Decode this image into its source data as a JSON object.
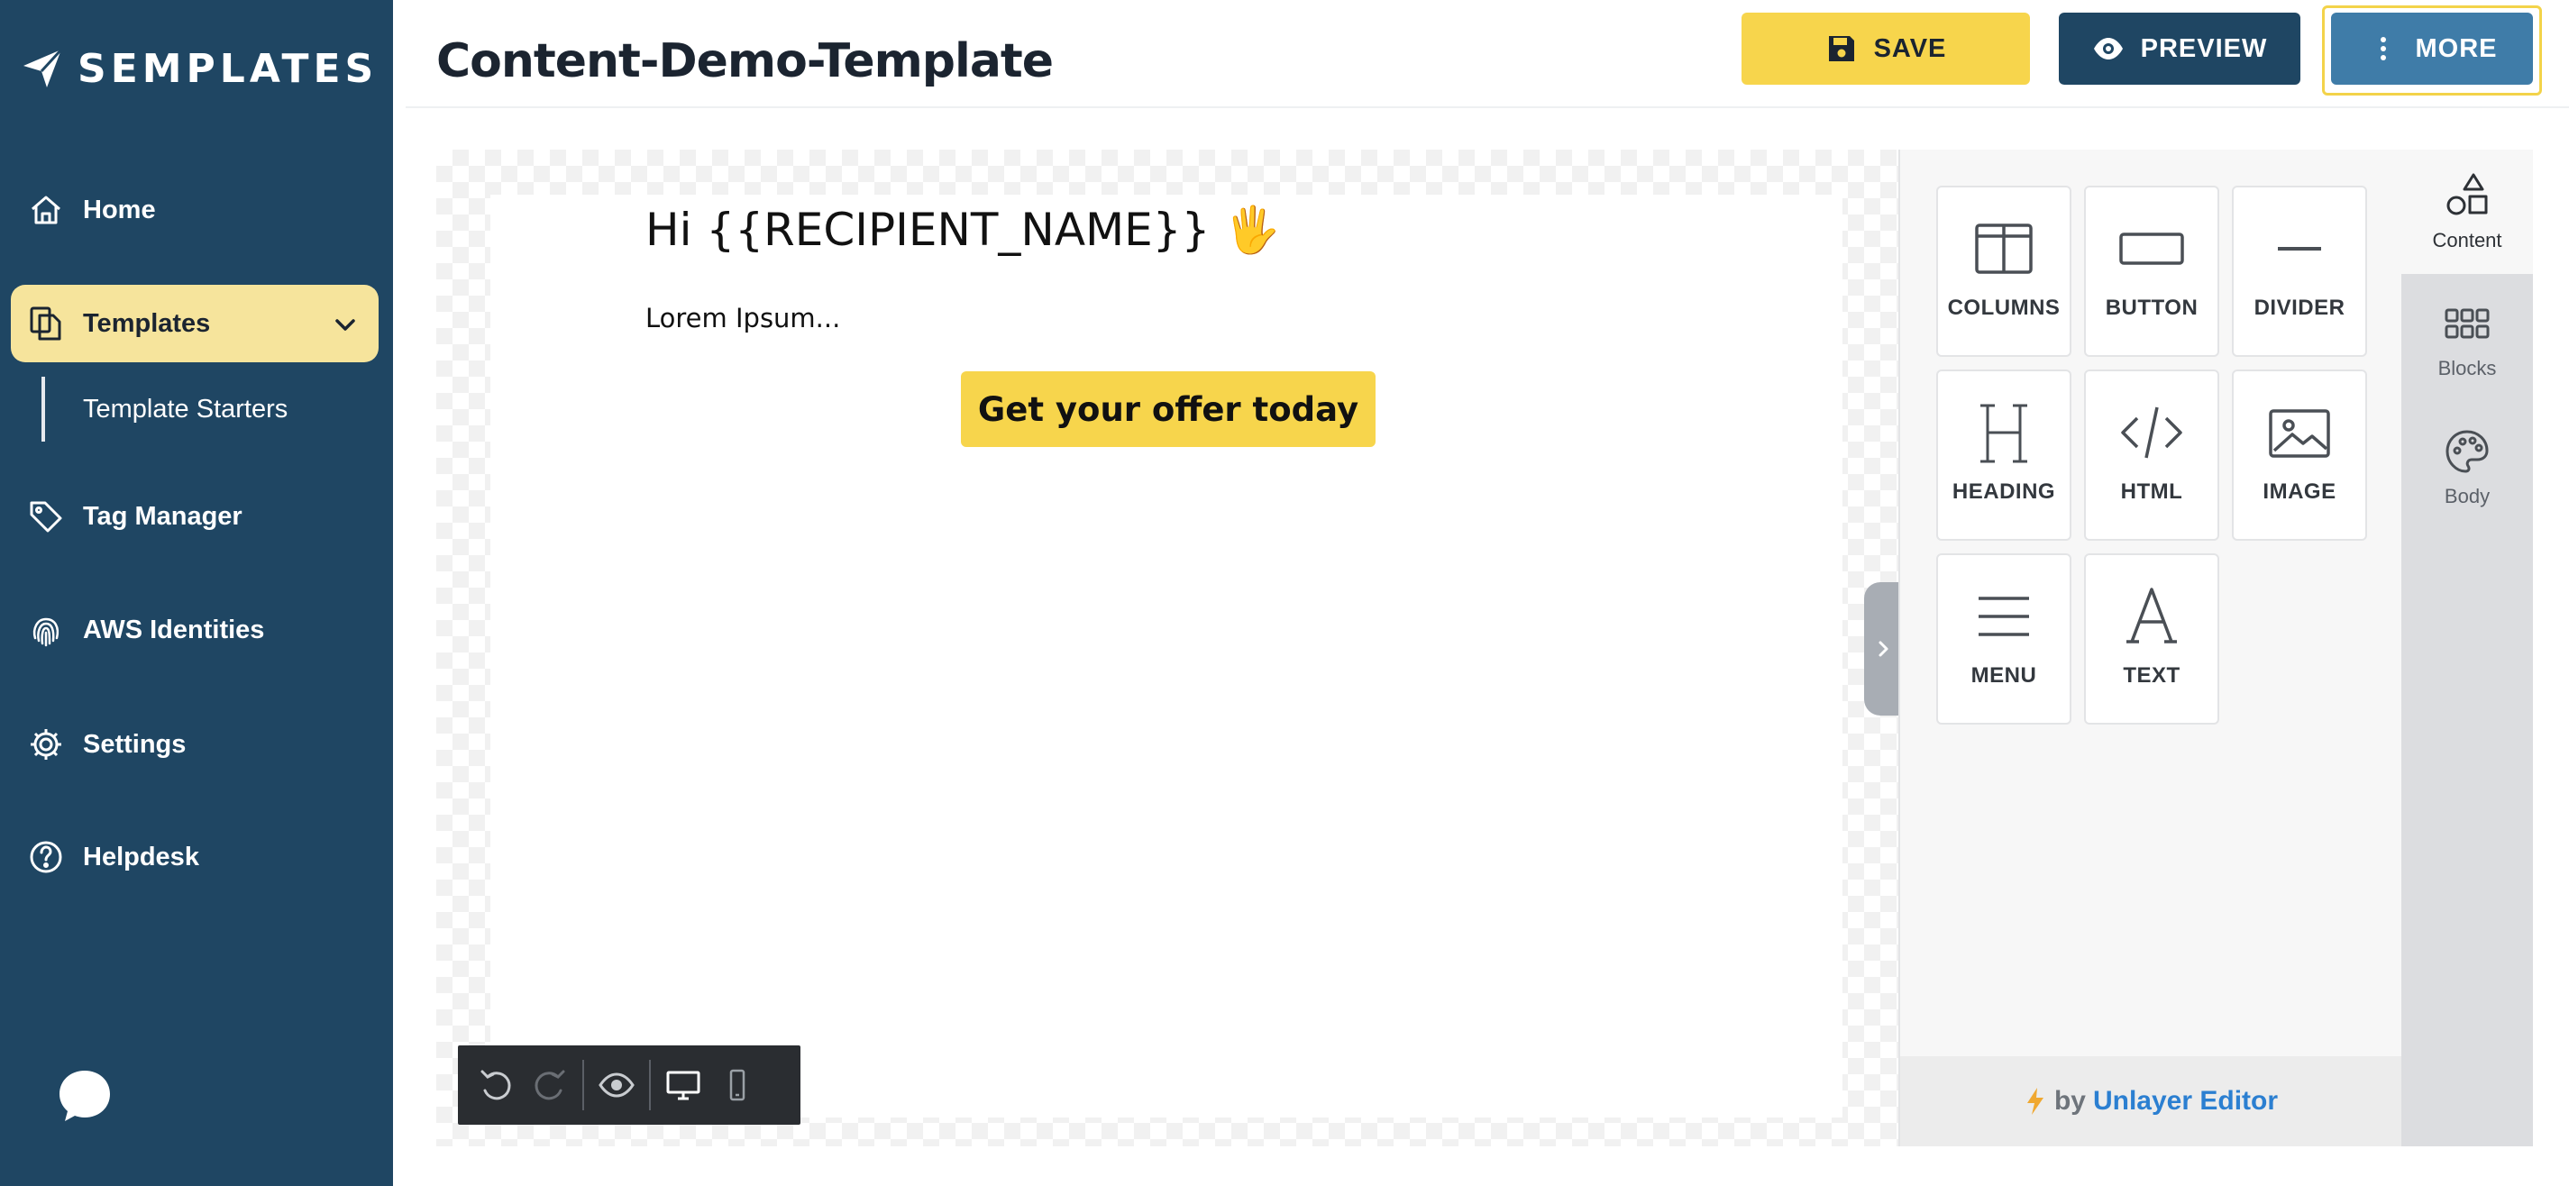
{
  "brand": {
    "name": "SEMPLATES"
  },
  "sidebar": {
    "items": [
      {
        "label": "Home"
      },
      {
        "label": "Templates"
      },
      {
        "label": "Tag Manager"
      },
      {
        "label": "AWS Identities"
      },
      {
        "label": "Settings"
      },
      {
        "label": "Helpdesk"
      }
    ],
    "sub_item": "Template Starters"
  },
  "header": {
    "title": "Content-Demo-Template",
    "save_label": "SAVE",
    "preview_label": "PREVIEW",
    "more_label": "MORE"
  },
  "email": {
    "greeting": "Hi {{RECIPIENT_NAME}} 🖐",
    "body": "Lorem Ipsum...",
    "cta": "Get your offer today"
  },
  "tools": [
    {
      "label": "COLUMNS",
      "icon": "columns-icon"
    },
    {
      "label": "BUTTON",
      "icon": "button-icon"
    },
    {
      "label": "DIVIDER",
      "icon": "divider-icon"
    },
    {
      "label": "HEADING",
      "icon": "heading-icon"
    },
    {
      "label": "HTML",
      "icon": "html-icon"
    },
    {
      "label": "IMAGE",
      "icon": "image-icon"
    },
    {
      "label": "MENU",
      "icon": "menu-icon"
    },
    {
      "label": "TEXT",
      "icon": "text-icon"
    }
  ],
  "tabs": [
    {
      "label": "Content",
      "icon": "shapes-icon"
    },
    {
      "label": "Blocks",
      "icon": "grid-icon"
    },
    {
      "label": "Body",
      "icon": "palette-icon"
    }
  ],
  "footer": {
    "by": "by",
    "link": "Unlayer Editor"
  },
  "colors": {
    "sidebar": "#1f4663",
    "accent_yellow": "#f7d54c",
    "active_nav": "#f6e49c",
    "more_button": "#3f7ca8",
    "link": "#2b7fd1"
  }
}
